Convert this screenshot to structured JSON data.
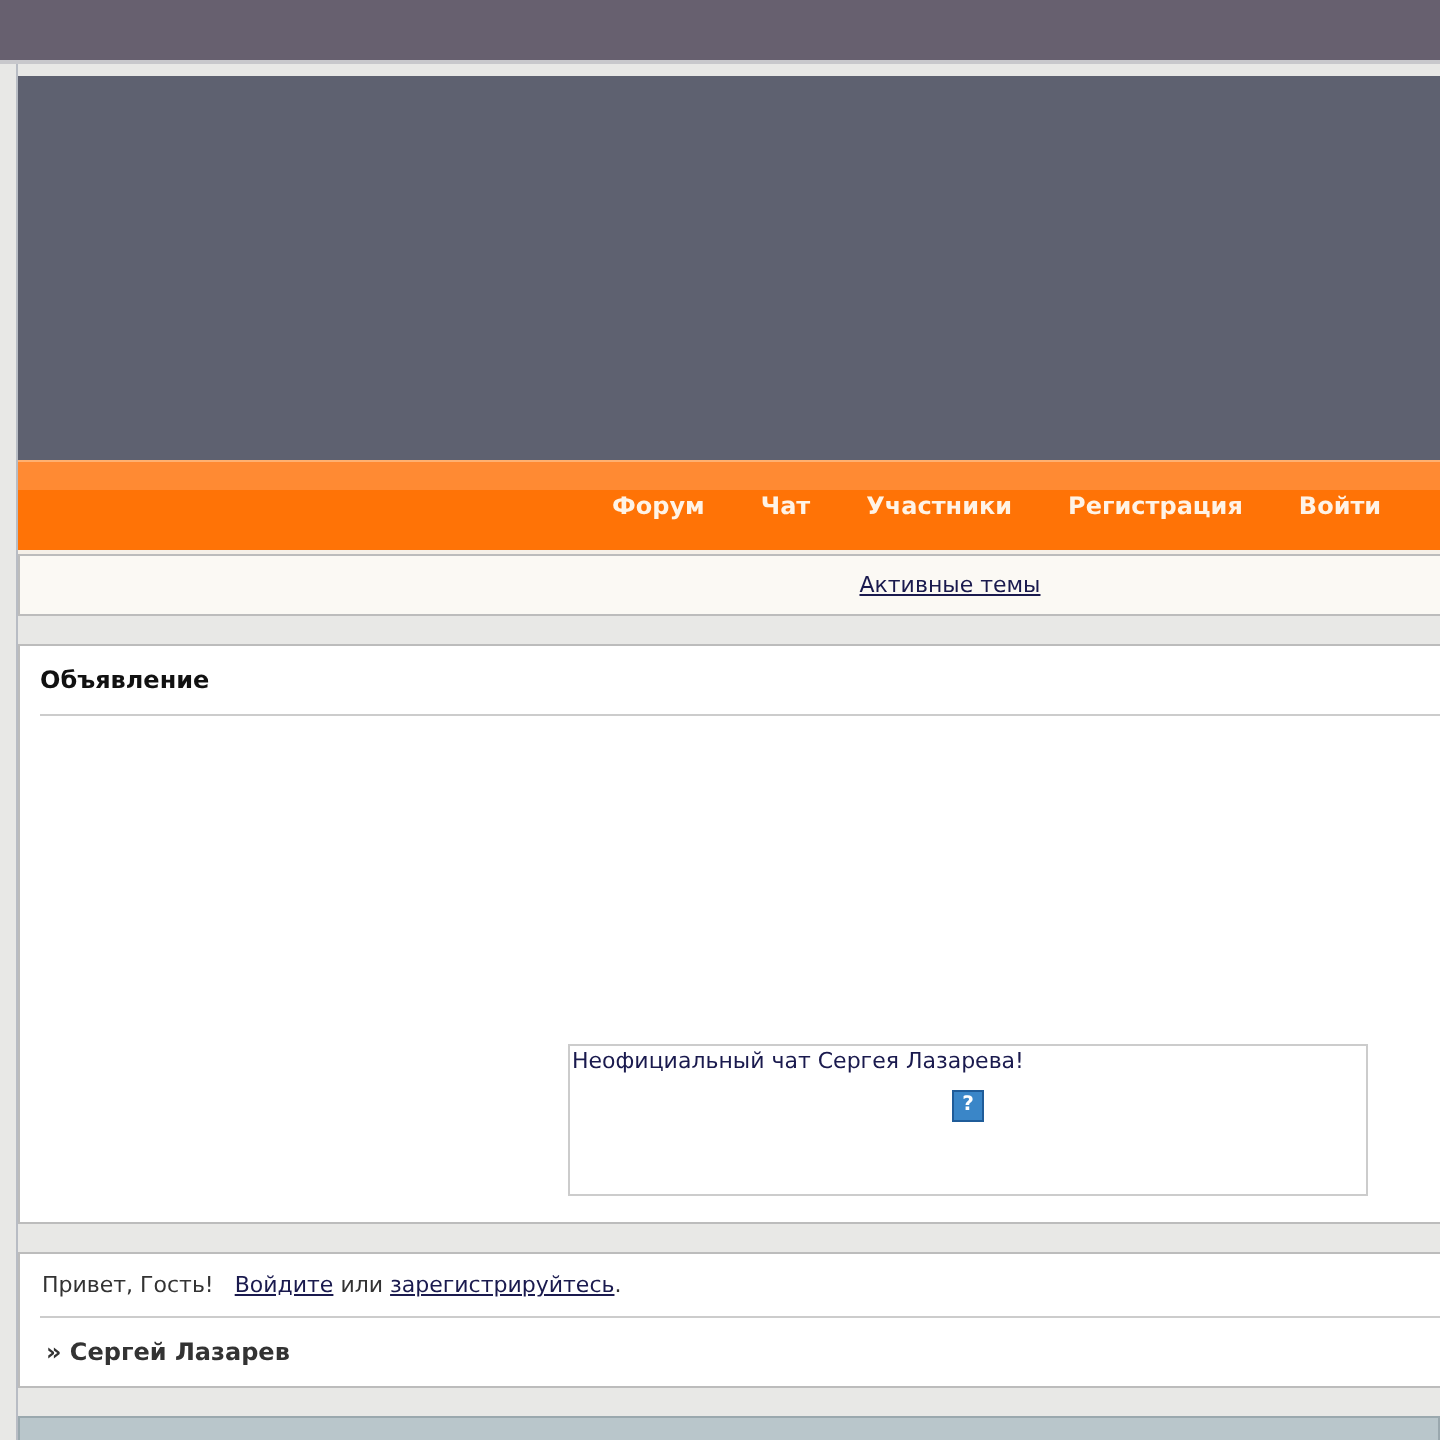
{
  "nav": [
    {
      "label": "Форум"
    },
    {
      "label": "Чат"
    },
    {
      "label": "Участники"
    },
    {
      "label": "Регистрация"
    },
    {
      "label": "Войти"
    }
  ],
  "sub_links": [
    "Активные темы"
  ],
  "announcement": {
    "title": "Объявление",
    "chat_box": {
      "text": "Неофициальный чат Сергея Лазарева!",
      "help_icon": "?"
    }
  },
  "welcome": {
    "greeting": "Привет, Гость!",
    "login_link": "Войдите",
    "or": "или",
    "register_link": "зарегистрируйтесь",
    "end": "."
  },
  "breadcrumb": "» Сергей Лазарев"
}
